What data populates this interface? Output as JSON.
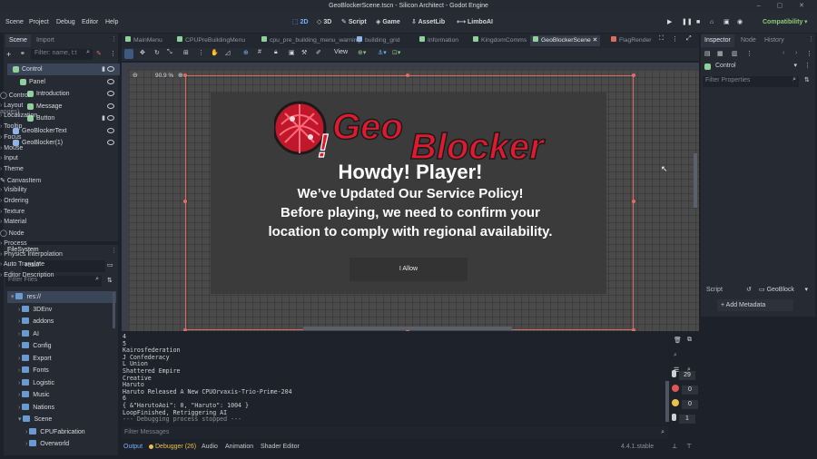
{
  "title_bar": {
    "title": "GeoBlockerScene.tscn - Silicon Architect - Godot Engine"
  },
  "menu": {
    "items": [
      "Scene",
      "Project",
      "Debug",
      "Editor",
      "Help"
    ]
  },
  "workspaces": [
    {
      "label": "2D",
      "icon": "2d-icon"
    },
    {
      "label": "3D",
      "icon": "3d-icon"
    },
    {
      "label": "Script",
      "icon": "script-icon"
    },
    {
      "label": "Game",
      "icon": "game-icon"
    },
    {
      "label": "AssetLib",
      "icon": "assetlib-icon"
    },
    {
      "label": "LimboAI",
      "icon": "limboai-icon"
    }
  ],
  "renderer": "Compatibility",
  "scene_dock": {
    "tabs": [
      "Scene",
      "Import"
    ],
    "filter_placeholder": "Filter: name, t:t",
    "nodes": [
      {
        "label": "Control",
        "depth": 0,
        "color": "#8ed19b"
      },
      {
        "label": "Panel",
        "depth": 1,
        "color": "#8ed19b"
      },
      {
        "label": "Introduction",
        "depth": 2,
        "color": "#8ed19b"
      },
      {
        "label": "Message",
        "depth": 2,
        "color": "#8ed19b"
      },
      {
        "label": "Button",
        "depth": 2,
        "color": "#8ed19b"
      },
      {
        "label": "GeoBlockerText",
        "depth": 0,
        "color": "#8fb5e8"
      },
      {
        "label": "GeoBlocker(1)",
        "depth": 0,
        "color": "#8fb5e8"
      }
    ]
  },
  "filesystem": {
    "title": "FileSystem",
    "path": "res://",
    "filter_placeholder": "Filter Files",
    "items": [
      "res://",
      "3DEnv",
      "addons",
      "AI",
      "Config",
      "Export",
      "Fonts",
      "Logistic",
      "Music",
      "Nations",
      "Scene",
      "CPUFabrication",
      "Overworld"
    ]
  },
  "editor_tabs": [
    "MainMenu",
    "CPUPreBuildingMenu",
    "cpu_pre_building_menu_warning",
    "building_grid",
    "Information",
    "KingdomComms",
    "GeoBlockerScene",
    "FlagRender"
  ],
  "toolbar": {
    "view_label": "View"
  },
  "viewport": {
    "zoom": "90.9 %",
    "logo_text": "Geo Blocker",
    "headline": "Howdy! Player!",
    "line2": "We’ve Updated Our Service Policy!",
    "line3": "Before playing, we need to confirm your",
    "line4": "location to comply with regional availability.",
    "button": "I Allow"
  },
  "output": {
    "lines": [
      "4",
      "5",
      "Kairosfederation",
      "J Confederacy",
      "L Union",
      "Shattered Empire",
      "Creative",
      "Haruto",
      "Haruto Released A New CPUOrvaxis-Trio-Prime-204",
      "6",
      "{ &\"HarutoAoi\": 0, \"Haruto\": 1004 }",
      "LoopFinished, Retriggering AI",
      "--- Debugging process stopped ---"
    ],
    "filter_placeholder": "Filter Messages",
    "counts": [
      "29",
      "0",
      "0",
      "1"
    ]
  },
  "bottom_tabs": [
    "Output",
    "Debugger (26)",
    "Audio",
    "Animation",
    "Shader Editor"
  ],
  "version": "4.4.1.stable",
  "inspector": {
    "tabs": [
      "Inspector",
      "Node",
      "History"
    ],
    "node_name": "Control",
    "filter_placeholder": "Filter Properties",
    "class_control": "Control",
    "layout_changes": "(2 changes)",
    "control_props": [
      "Layout",
      "Localization",
      "Tooltip",
      "Focus",
      "Mouse",
      "Input",
      "Theme"
    ],
    "class_canvasitem": "CanvasItem",
    "canvas_props": [
      "Visibility",
      "Ordering",
      "Texture",
      "Material"
    ],
    "class_node": "Node",
    "node_props": [
      "Process",
      "Physics Interpolation",
      "Auto Translate",
      "Editor Description"
    ],
    "script_label": "Script",
    "script_value": "GeoBlock",
    "add_metadata": "Add Metadata"
  }
}
